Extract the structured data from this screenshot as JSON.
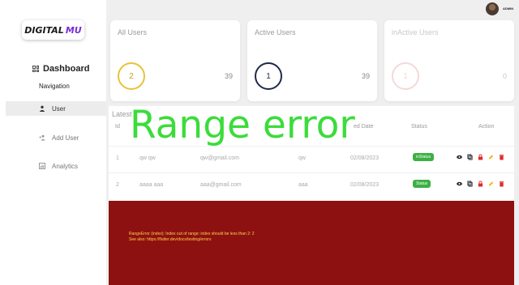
{
  "sidebar": {
    "logo_part1": "DIGITAL",
    "logo_part2": "MU",
    "dashboard_label": "Dashboard",
    "navigation_label": "Navigation",
    "items": [
      {
        "label": "User",
        "icon": "person-icon",
        "active": true
      },
      {
        "label": "Add User",
        "icon": "add-user-icon",
        "active": false
      },
      {
        "label": "Analytics",
        "icon": "analytics-icon",
        "active": false
      }
    ]
  },
  "topbar": {
    "user_label": "ADMIN"
  },
  "stats": [
    {
      "title": "All Users",
      "circle_value": "2",
      "total": "39"
    },
    {
      "title": "Active Users",
      "circle_value": "1",
      "total": "39"
    },
    {
      "title": "inActive Users",
      "circle_value": "1",
      "total": "0"
    }
  ],
  "table": {
    "title": "Latest",
    "headers": [
      "Id",
      "ed Date",
      "Status",
      "Action"
    ],
    "rows": [
      {
        "id": "1",
        "name": "qw qw",
        "email": "qw@gmail.com",
        "org": "qw",
        "date": "02/08/2023",
        "status": "inStatus"
      },
      {
        "id": "2",
        "name": "aaaa aaa",
        "email": "aaa@gmail.com",
        "org": "aaa",
        "date": "02/08/2023",
        "status": "Status"
      }
    ]
  },
  "banner": "Range error",
  "error": {
    "line1": "RangeError (index): Index out of range: index should be less than 2: 2",
    "line2": "See also: https://flutter.dev/docs/testing/errors"
  },
  "colors": {
    "accent_purple": "#7a2bd6",
    "status_green": "#3cb043",
    "error_bg": "#8e1111",
    "error_text": "#ffd54a",
    "banner_green": "#3bdc3b"
  }
}
